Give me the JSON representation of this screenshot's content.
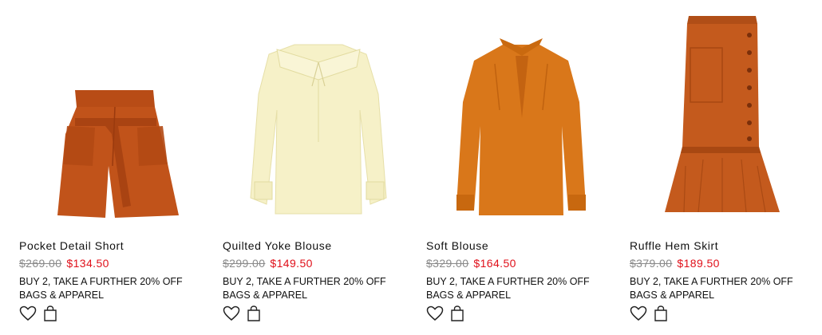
{
  "products": [
    {
      "name": "Pocket Detail Short",
      "original_price": "$269.00",
      "sale_price": "$134.50",
      "promo": "BUY 2, TAKE A FURTHER 20% OFF BAGS & APPAREL",
      "color": "#c1531a",
      "icons": [
        "heart-icon",
        "shopping-bag-icon"
      ]
    },
    {
      "name": "Quilted Yoke Blouse",
      "original_price": "$299.00",
      "sale_price": "$149.50",
      "promo": "BUY 2, TAKE A FURTHER 20% OFF BAGS & APPAREL",
      "color": "#f6f1c8",
      "icons": [
        "heart-icon",
        "shopping-bag-icon"
      ]
    },
    {
      "name": "Soft Blouse",
      "original_price": "$329.00",
      "sale_price": "$164.50",
      "promo": "BUY 2, TAKE A FURTHER 20% OFF BAGS & APPAREL",
      "color": "#d9771a",
      "icons": [
        "heart-icon",
        "shopping-bag-icon"
      ]
    },
    {
      "name": "Ruffle Hem Skirt",
      "original_price": "$379.00",
      "sale_price": "$189.50",
      "promo": "BUY 2, TAKE A FURTHER 20% OFF BAGS & APPAREL",
      "color": "#c45a1d",
      "icons": [
        "heart-icon",
        "shopping-bag-icon"
      ]
    }
  ],
  "colors": {
    "sale": "#e0101a",
    "strikethrough": "#8a8a8a",
    "text": "#111111"
  }
}
